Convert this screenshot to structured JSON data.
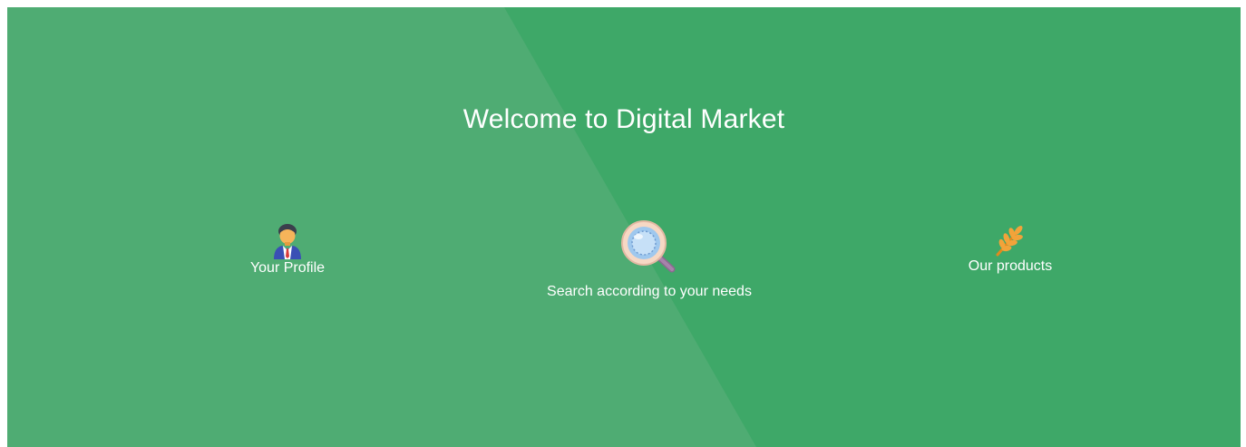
{
  "hero": {
    "title": "Welcome to Digital Market",
    "background_color": "#3ea868",
    "diagonal_overlay_color": "#4fac73"
  },
  "features": [
    {
      "label": "Your Profile",
      "icon": "user-profile-icon"
    },
    {
      "label": "Search according to your needs",
      "icon": "magnifier-search-icon"
    },
    {
      "label": "Our products",
      "icon": "wheat-icon"
    }
  ]
}
